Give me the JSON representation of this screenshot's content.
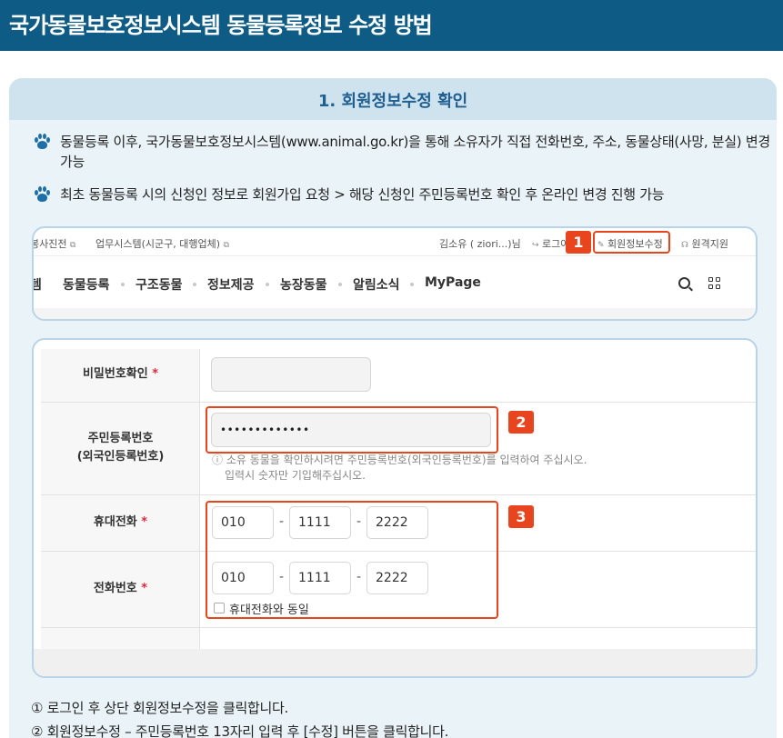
{
  "header": {
    "title": "국가동물보호정보시스템 동물등록정보 수정 방법"
  },
  "section": {
    "title": "1. 회원정보수정 확인",
    "bullets": [
      "동물등록 이후, 국가동물보호정보시스템(www.animal.go.kr)을 통해 소유자가 직접 전화번호, 주소, 동물상태(사망, 분실) 변경 가능",
      "최초 동물등록 시의 신청인 정보로 회원가입 요청 > 해당 신청인 주민등록번호 확인 후 온라인 변경 진행 가능"
    ],
    "bullet_icon": "paw-icon",
    "accent_color": "#1e6ea8"
  },
  "screenshot1": {
    "topbar": {
      "link1": "봉사진전",
      "link2": "업무시스템(시군구, 대행업체)",
      "user": "김소유 ( ziori...)님",
      "login": "로그아웃",
      "edit": "회원정보수정",
      "remote": "원격지원"
    },
    "nav": {
      "partial": "템",
      "items": [
        "동물등록",
        "구조동물",
        "정보제공",
        "농장동물",
        "알림소식",
        "MyPage"
      ]
    },
    "callout": "1"
  },
  "screenshot2": {
    "rows": {
      "password_confirm": {
        "label": "비밀번호확인",
        "required": "*"
      },
      "resident_no": {
        "label1": "주민등록번호",
        "label2": "(외국인등록번호)",
        "value": "•••••••••••••",
        "help1": "ⓘ 소유 동물을 확인하시려면 주민등록번호(외국인등록번호)를 입력하여 주십시오.",
        "help2": "입력시 숫자만 기입해주십시오."
      },
      "mobile": {
        "label": "휴대전화",
        "required": "*",
        "p1": "010",
        "p2": "1111",
        "p3": "2222"
      },
      "phone": {
        "label": "전화번호",
        "required": "*",
        "p1": "010",
        "p2": "1111",
        "p3": "2222",
        "same_label": "휴대전화와 동일"
      }
    },
    "dash": "-",
    "callout2": "2",
    "callout3": "3",
    "callout_color": "#e8451e"
  },
  "steps": [
    "① 로그인 후 상단 회원정보수정을 클릭합니다.",
    "② 회원정보수정 – 주민등록번호 13자리 입력 후 [수정] 버튼을 클릭합니다."
  ]
}
